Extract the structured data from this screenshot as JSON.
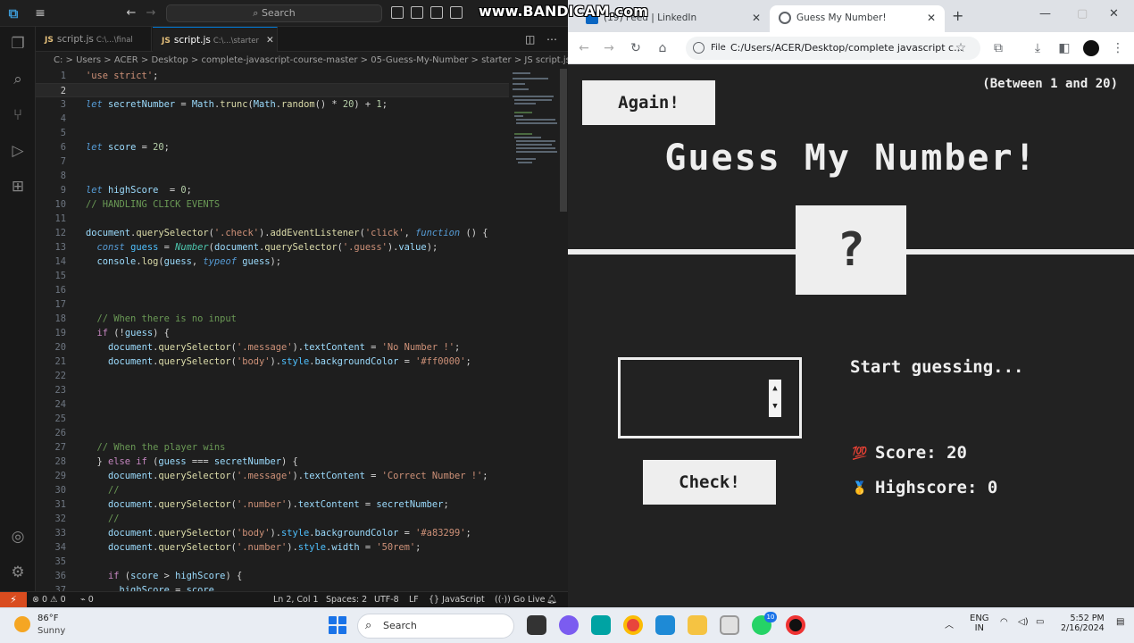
{
  "vscode": {
    "search_placeholder": "Search",
    "tabs": [
      {
        "name": "script.js",
        "path": "C:\\...\\final"
      },
      {
        "name": "script.js",
        "path": "C:\\...\\starter"
      }
    ],
    "breadcrumb": "C: > Users > ACER > Desktop > complete-javascript-course-master > 05-Guess-My-Number > starter > JS script.js > ...",
    "status": {
      "errors": "0",
      "warnings": "0",
      "ports": "0",
      "position": "Ln 2, Col 1",
      "spaces": "Spaces: 2",
      "encoding": "UTF-8",
      "eol": "LF",
      "language": "JavaScript",
      "golive": "Go Live"
    }
  },
  "watermark": "www.BANDICAM.com",
  "chrome": {
    "tabs": [
      {
        "title": "(19) Feed | LinkedIn"
      },
      {
        "title": "Guess My Number!"
      }
    ],
    "url_scheme": "File",
    "url": "C:/Users/ACER/Desktop/complete javascript c..."
  },
  "game": {
    "again_label": "Again!",
    "between": "(Between 1 and 20)",
    "title": "Guess My Number!",
    "number": "?",
    "check_label": "Check!",
    "message": "Start guessing...",
    "score_label": "Score:",
    "score": "20",
    "highscore_label": "Highscore:",
    "highscore": "0",
    "score_icon": "💯",
    "highscore_icon": "🥇"
  },
  "taskbar": {
    "temperature": "86°F",
    "weather": "Sunny",
    "search": "Search",
    "lang1": "ENG",
    "lang2": "IN",
    "time": "5:52 PM",
    "date": "2/16/2024",
    "badge": "10"
  }
}
